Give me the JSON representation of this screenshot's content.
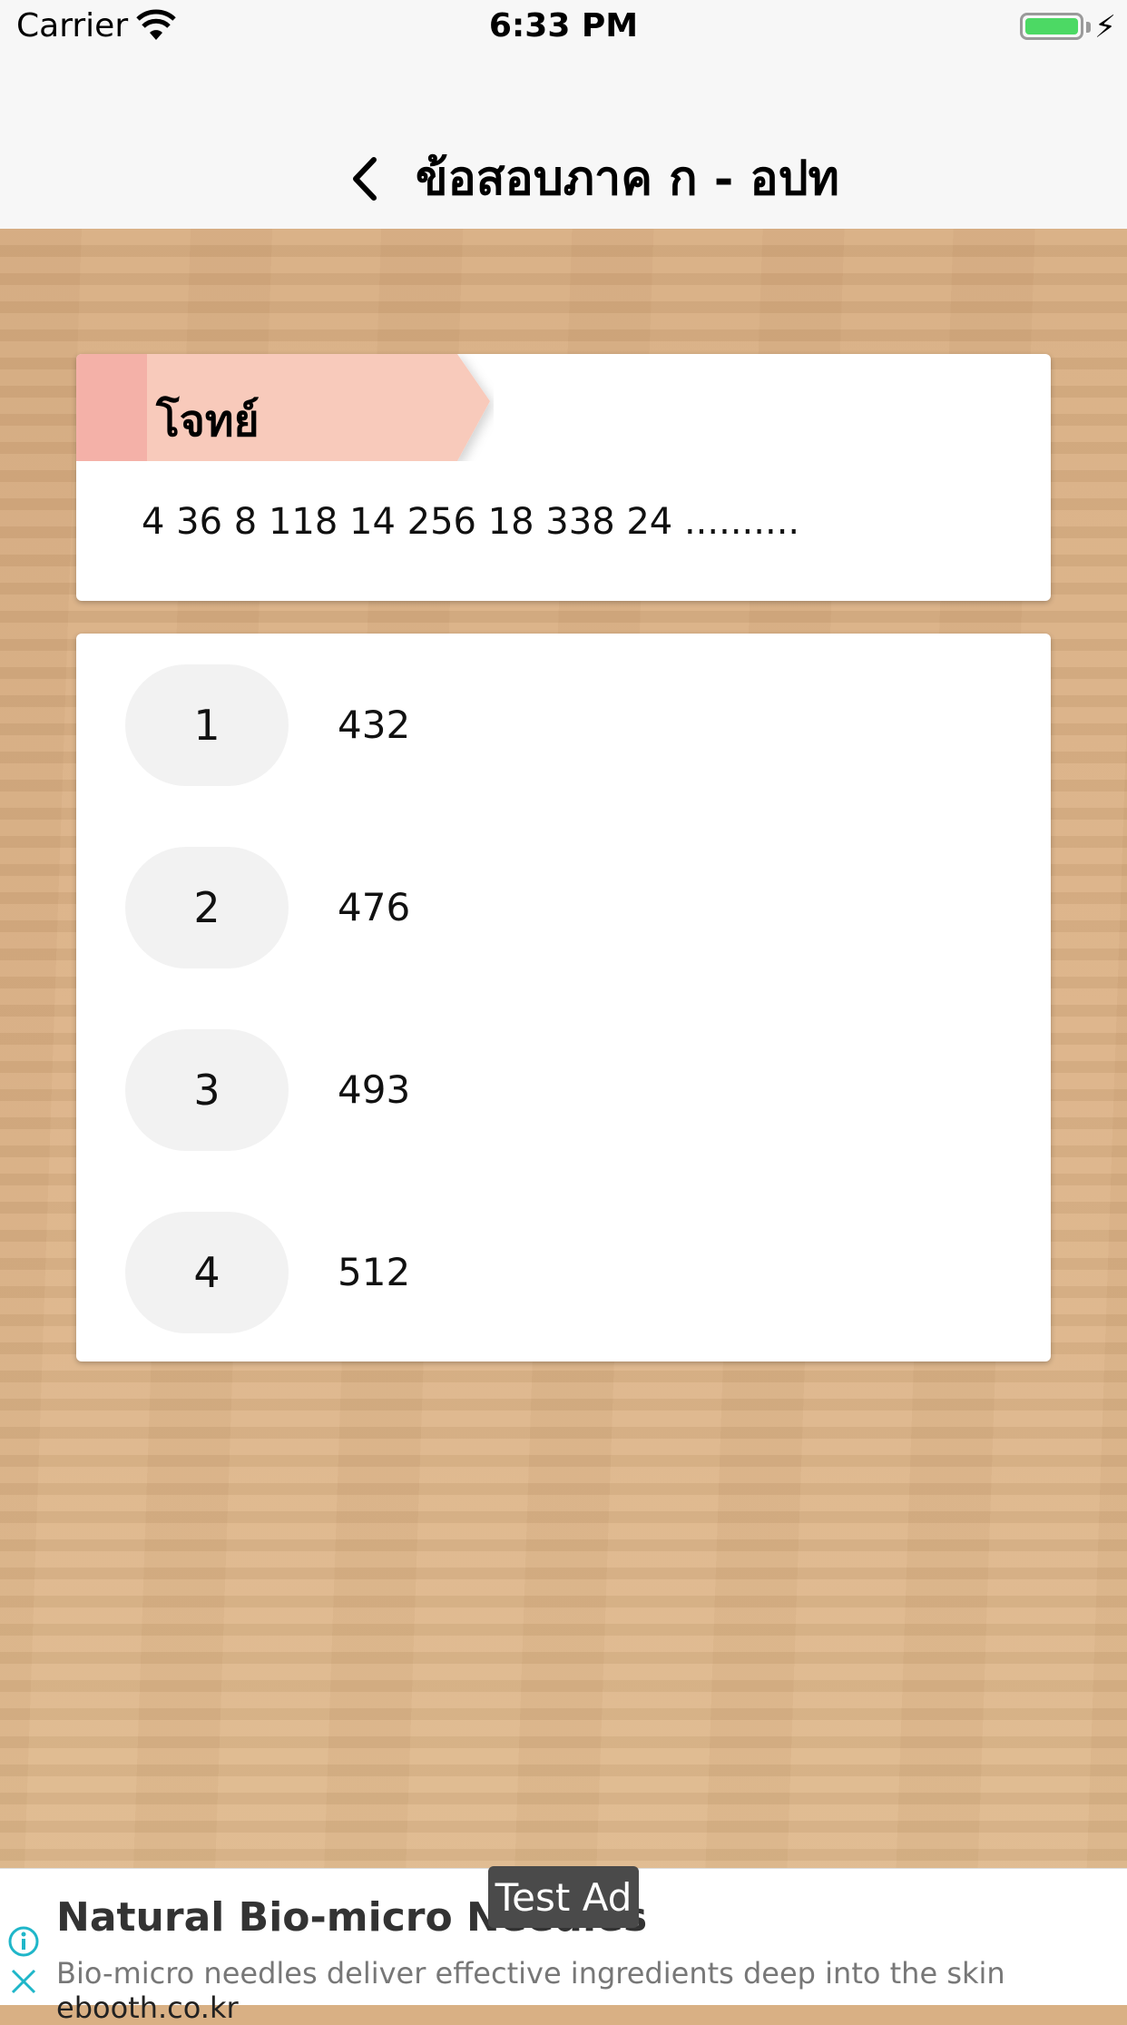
{
  "status_bar": {
    "carrier": "Carrier",
    "time": "6:33 PM"
  },
  "nav": {
    "title": "ข้อสอบภาค ก - อปท",
    "back_icon": "chevron-left-icon"
  },
  "question": {
    "ribbon_label": "โจทย์",
    "text": "4 36 8 118 14 256 18 338 24 ..........",
    "ribbon_colors": {
      "main": "#f8cabb",
      "accent": "#f4b1a8"
    }
  },
  "choices": [
    {
      "number": "1",
      "value": "432"
    },
    {
      "number": "2",
      "value": "476"
    },
    {
      "number": "3",
      "value": "493"
    },
    {
      "number": "4",
      "value": "512"
    }
  ],
  "ad": {
    "badge": "Test Ad",
    "title": "Natural Bio-micro Needles",
    "description": "Bio-micro needles deliver effective ingredients deep into the skin",
    "domain": "ebooth.co.kr",
    "info_icon": "info-icon",
    "close_icon": "close-icon"
  }
}
